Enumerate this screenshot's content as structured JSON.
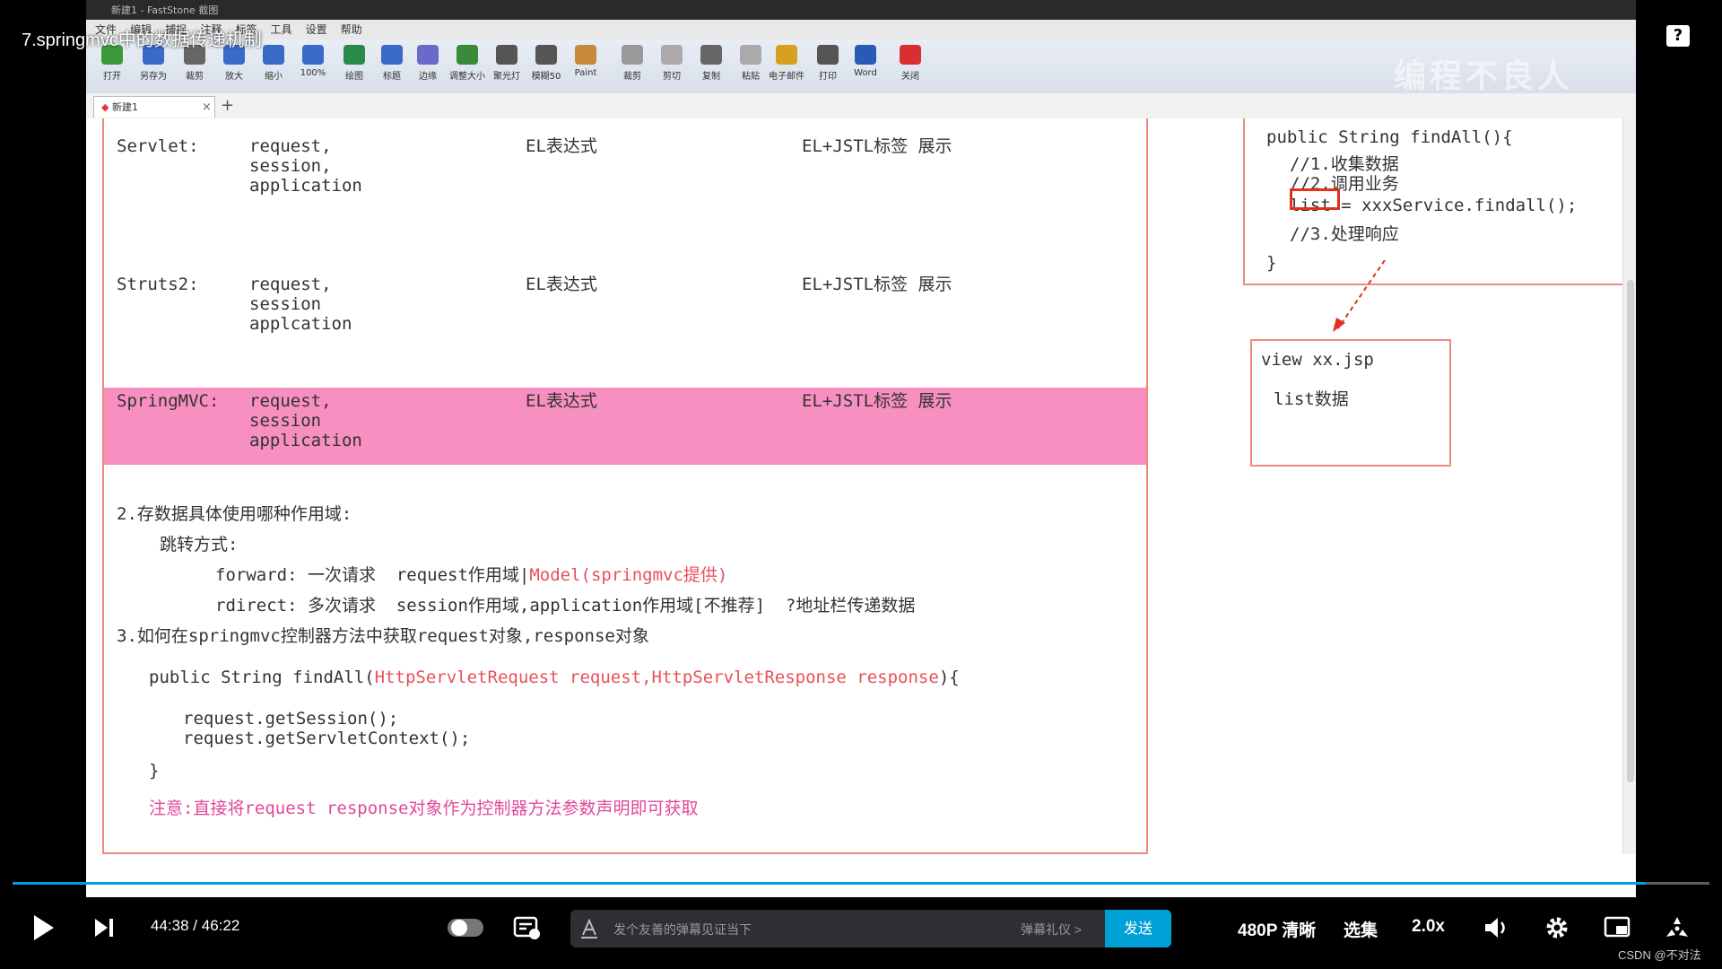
{
  "video_title": "7.springmvc中的数据传递机制",
  "help_label": "?",
  "app": {
    "window_title": "新建1 - FastStone 截图",
    "menus": [
      "文件",
      "编辑",
      "捕捉",
      "注释",
      "标签",
      "工具",
      "设置",
      "帮助"
    ],
    "toolbar": [
      "打开",
      "另存为",
      "裁剪",
      "放大",
      "缩小",
      "100%",
      "绘图",
      "标题",
      "边缘",
      "调整大小",
      "聚光灯",
      "模糊50",
      "Paint",
      "裁剪",
      "剪切",
      "复制",
      "粘贴",
      "电子邮件",
      "打印",
      "Word",
      "关闭"
    ],
    "watermark": "编程不良人",
    "tab_label": "新建1",
    "tab_close": "×",
    "tab_add": "+"
  },
  "slide": {
    "rows": [
      {
        "label": "Servlet:",
        "scopes": "request,\nsession,\napplication",
        "expr": "EL表达式",
        "tag": "EL+JSTL标签 展示"
      },
      {
        "label": "Struts2:",
        "scopes": "request,\nsession\napplcation",
        "expr": "EL表达式",
        "tag": "EL+JSTL标签 展示"
      },
      {
        "label": "SpringMVC:",
        "scopes": "request,\nsession\napplication",
        "expr": "EL表达式",
        "tag": "EL+JSTL标签 展示"
      }
    ],
    "section2_title": "2.存数据具体使用哪种作用域:",
    "jump_label": "跳转方式:",
    "forward_prefix": "forward: 一次请求  request作用域|",
    "forward_model": "Model(springmvc提供)",
    "redirect_line": "rdirect: 多次请求  session作用域,application作用域[不推荐]  ?地址栏传递数据",
    "section3_title": "3.如何在springmvc控制器方法中获取request对象,response对象",
    "method_prefix": "public String findAll(",
    "method_params": "HttpServletRequest request,HttpServletResponse response",
    "method_suffix": "){",
    "code_line1": "request.getSession();",
    "code_line2": "request.getServletContext();",
    "close_brace": "}",
    "note": "注意:直接将request response对象作为控制器方法参数声明即可获取",
    "right_code": {
      "signature": "public String findAll(){",
      "c1": "//1.收集数据",
      "c2": "//2.调用业务",
      "list_word": "list",
      "assign": " = xxxService.findall();",
      "c3": "//3.处理响应",
      "end": "}"
    },
    "view_box": {
      "title": "view xx.jsp",
      "content": "list数据"
    }
  },
  "player": {
    "current_time": "44:38",
    "separator": "/",
    "duration": "46:22",
    "progress": 0.9626,
    "danmaku_placeholder": "发个友善的弹幕见证当下",
    "danmaku_etiquette": "弹幕礼仪 >",
    "send_label": "发送",
    "quality": "480P 清晰",
    "episodes": "选集",
    "speed": "2.0x",
    "watermark_credit": "CSDN @不对法",
    "accent_color": "#00a1d6"
  }
}
